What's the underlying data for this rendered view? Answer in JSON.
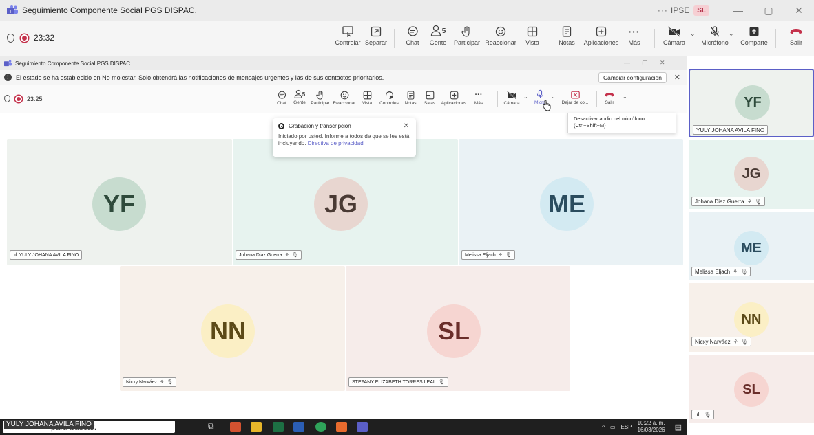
{
  "colors": {
    "accent": "#5b5fc7",
    "leave": "#c4314b",
    "recording": "#c4314b"
  },
  "outer_window": {
    "title": "Seguimiento Componente Social PGS DISPAC.",
    "more": "···",
    "org": "IPSE",
    "user_initials": "SL",
    "minimize": "—",
    "restore": "▢",
    "close": "✕"
  },
  "outer_toolbar": {
    "timer": "23:32",
    "items": [
      {
        "label": "Controlar",
        "icon": "control-icon"
      },
      {
        "label": "Separar",
        "icon": "popout-icon"
      },
      {
        "label": "Chat",
        "icon": "chat-icon"
      },
      {
        "label": "Gente",
        "icon": "people-icon",
        "count": "5"
      },
      {
        "label": "Participar",
        "icon": "raise-hand-icon"
      },
      {
        "label": "Reaccionar",
        "icon": "react-icon"
      },
      {
        "label": "Vista",
        "icon": "view-icon"
      },
      {
        "label": "Notas",
        "icon": "notes-icon"
      },
      {
        "label": "Aplicaciones",
        "icon": "apps-icon"
      },
      {
        "label": "Más",
        "icon": "more-icon"
      },
      {
        "label": "Cámara",
        "icon": "camera-off-icon"
      },
      {
        "label": "Micrófono",
        "icon": "mic-off-icon"
      },
      {
        "label": "Comparte",
        "icon": "share-icon"
      },
      {
        "label": "Salir",
        "icon": "leave-icon"
      }
    ]
  },
  "inner_window": {
    "title": "Seguimiento Componente Social PGS DISPAC.",
    "more": "···",
    "minimize": "—",
    "restore": "▢",
    "close": "✕",
    "notification": "El estado se ha establecido en No molestar. Solo obtendrá las notificaciones de mensajes urgentes y las de sus contactos prioritarios.",
    "change_settings": "Cambiar configuración",
    "notif_close": "✕"
  },
  "inner_toolbar": {
    "timer": "23:25",
    "items": [
      {
        "label": "Chat",
        "icon": "chat-icon"
      },
      {
        "label": "Gente",
        "icon": "people-icon",
        "count": "5"
      },
      {
        "label": "Participar",
        "icon": "raise-hand-icon"
      },
      {
        "label": "Reaccionar",
        "icon": "react-icon"
      },
      {
        "label": "Vista",
        "icon": "view-icon"
      },
      {
        "label": "Controles",
        "icon": "controls-icon"
      },
      {
        "label": "Notas",
        "icon": "notes-icon"
      },
      {
        "label": "Salas",
        "icon": "rooms-icon"
      },
      {
        "label": "Aplicaciones",
        "icon": "apps-icon"
      },
      {
        "label": "Más",
        "icon": "more-icon"
      },
      {
        "label": "Cámara",
        "icon": "camera-off-icon"
      },
      {
        "label": "Micro",
        "icon": "mic-icon"
      },
      {
        "label": "Dejar de co...",
        "icon": "stop-share-icon"
      },
      {
        "label": "Salir",
        "icon": "leave-icon"
      }
    ]
  },
  "tooltip": {
    "line1": "Desactivar audio del micrófono",
    "line2": "(Ctrl+Shift+M)"
  },
  "recording_popup": {
    "title": "Grabación y transcripción",
    "body": "Iniciado por usted. Informe a todos de que se les está incluyendo.",
    "link": "Directiva de privacidad",
    "close": "✕"
  },
  "participants": [
    {
      "initials": "YF",
      "name": "YULY JOHANA AVILA FINO",
      "avatar_bg": "#c7dccf",
      "avatar_fg": "#2e4a3b",
      "tile_bg": "#eef2ee"
    },
    {
      "initials": "JG",
      "name": "Johana Diaz Guerra",
      "avatar_bg": "#e8d6d0",
      "avatar_fg": "#4a3a34",
      "tile_bg": "#e7f3ef"
    },
    {
      "initials": "ME",
      "name": "Melissa Eljach",
      "avatar_bg": "#d3eaf2",
      "avatar_fg": "#2a4c5e",
      "tile_bg": "#eaf2f5"
    },
    {
      "initials": "NN",
      "name": "Nicxy Narváez",
      "avatar_bg": "#fbefc5",
      "avatar_fg": "#5c4a18",
      "tile_bg": "#f7f0ea"
    },
    {
      "initials": "SL",
      "name": "STEFANY ELIZABETH TORRES LEAL",
      "avatar_bg": "#f6d5d1",
      "avatar_fg": "#6a2e2a",
      "tile_bg": "#f6ecea"
    }
  ],
  "taskbar": {
    "search_text": "para buscar.",
    "speaker_name": "YULY JOHANA AVILA FINO",
    "tray_caret": "^",
    "lang": "ESP",
    "time": "10:22 a. m.",
    "date": "16/03/2026"
  }
}
